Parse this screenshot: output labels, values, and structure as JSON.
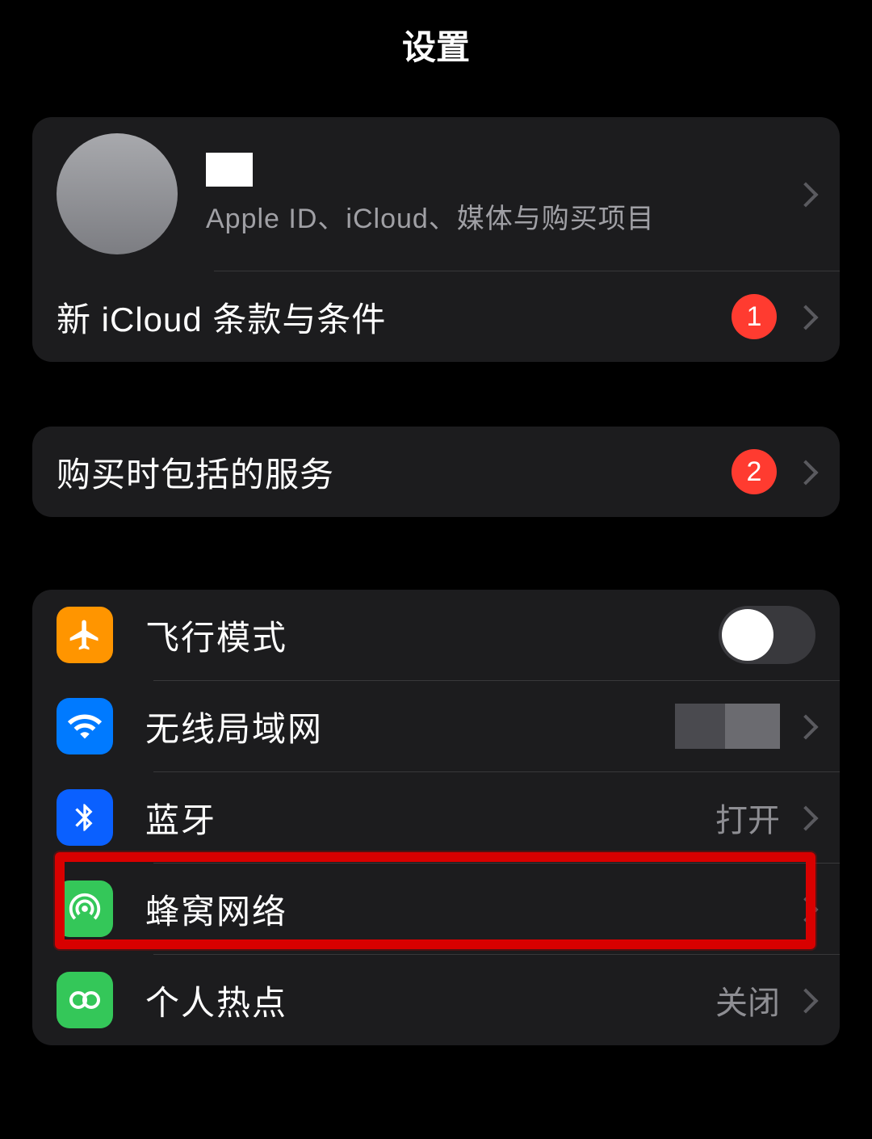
{
  "header": {
    "title": "设置"
  },
  "account": {
    "name_redacted": true,
    "subtitle": "Apple ID、iCloud、媒体与购买项目",
    "terms_row": {
      "label": "新 iCloud 条款与条件",
      "badge": "1"
    }
  },
  "services": {
    "label": "购买时包括的服务",
    "badge": "2"
  },
  "network": {
    "airplane": {
      "label": "飞行模式",
      "icon": "airplane-icon",
      "toggle_on": false
    },
    "wifi": {
      "label": "无线局域网",
      "icon": "wifi-icon",
      "value_redacted": true
    },
    "bluetooth": {
      "label": "蓝牙",
      "icon": "bluetooth-icon",
      "value": "打开"
    },
    "cellular": {
      "label": "蜂窝网络",
      "icon": "cellular-icon",
      "highlighted": true
    },
    "hotspot": {
      "label": "个人热点",
      "icon": "hotspot-icon",
      "value": "关闭"
    }
  }
}
